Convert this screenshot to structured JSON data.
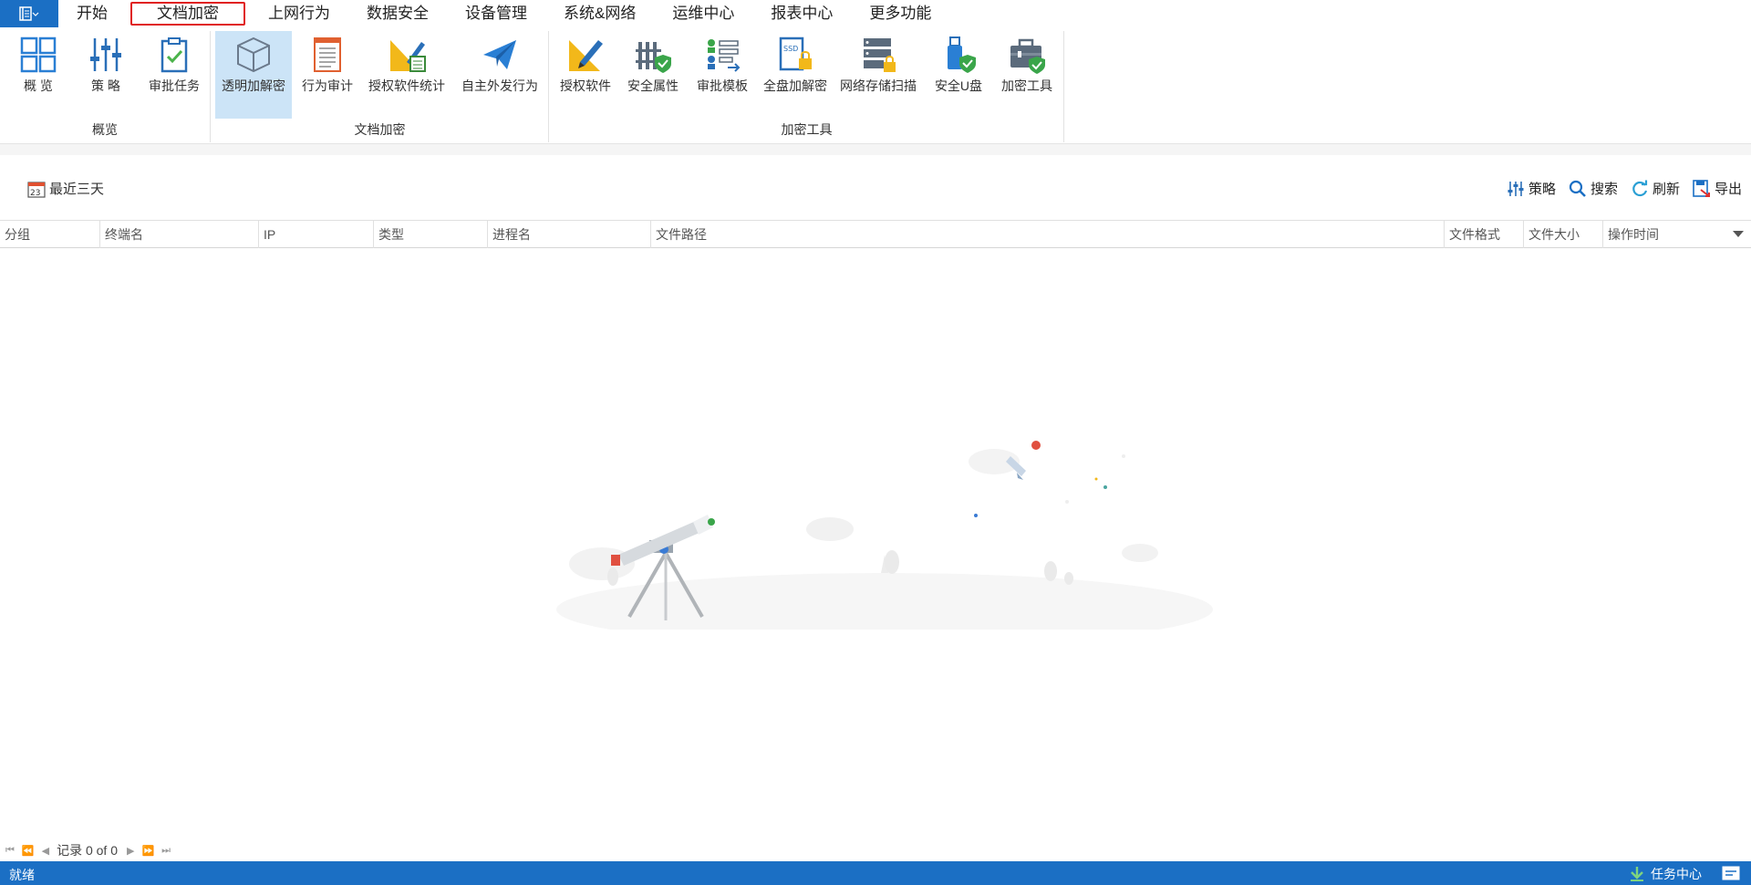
{
  "menubar": {
    "items": [
      "开始",
      "文档加密",
      "上网行为",
      "数据安全",
      "设备管理",
      "系统&网络",
      "运维中心",
      "报表中心",
      "更多功能"
    ],
    "active_index": 1
  },
  "ribbon": {
    "groups": [
      {
        "label": "概览",
        "buttons": [
          "概 览",
          "策 略",
          "审批任务"
        ]
      },
      {
        "label": "文档加密",
        "buttons": [
          "透明加解密",
          "行为审计",
          "授权软件统计",
          "自主外发行为"
        ]
      },
      {
        "label": "加密工具",
        "buttons": [
          "授权软件",
          "安全属性",
          "审批模板",
          "全盘加解密",
          "网络存储扫描",
          "安全U盘",
          "加密工具"
        ]
      }
    ],
    "selected_button": "透明加解密"
  },
  "toolbar": {
    "date_filter": "最近三天",
    "date_icon_text": "23",
    "actions": [
      "策略",
      "搜索",
      "刷新",
      "导出"
    ]
  },
  "table": {
    "columns": [
      "分组",
      "终端名",
      "IP",
      "类型",
      "进程名",
      "文件路径",
      "文件格式",
      "文件大小",
      "操作时间"
    ],
    "rows": []
  },
  "pager": {
    "record_text": "记录 0 of 0"
  },
  "status": {
    "left": "就绪",
    "task_center": "任务中心"
  },
  "colors": {
    "accent": "#1b6fc4",
    "selected": "#cce4f7",
    "highlight": "#e02020"
  }
}
